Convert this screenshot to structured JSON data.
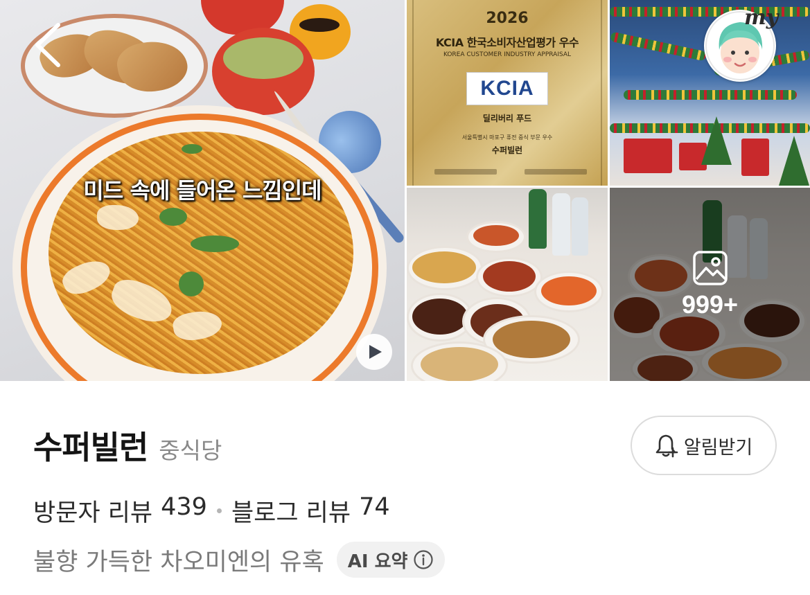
{
  "gallery": {
    "main": {
      "caption": "미드 속에 들어온 느낌인데"
    },
    "award": {
      "year": "2026",
      "title": "KCIA 한국소비자산업평가 우수",
      "subtitle": "KOREA CUSTOMER INDUSTRY APPRAISAL",
      "logo_text": "KCIA",
      "category": "딜리버리 푸드",
      "description": "서울특별시 마포구 퓨전 중식 부문 우수",
      "name": "수퍼빌런"
    },
    "my_label": "my",
    "photo_count": "999+"
  },
  "shop": {
    "name": "수퍼빌런",
    "category": "중식당",
    "notify_label": "알림받기"
  },
  "reviews": {
    "visitor_label": "방문자 리뷰",
    "visitor_count": "439",
    "blog_label": "블로그 리뷰",
    "blog_count": "74"
  },
  "summary": {
    "text": "불향 가득한 차오미엔의 유혹",
    "chip_label": "AI 요약"
  },
  "icons": {
    "back": "chevron-left-icon",
    "play": "play-icon",
    "photos": "image-icon",
    "bell": "bell-plus-icon",
    "info": "info-icon"
  },
  "colors": {
    "plate_ring": "#ec7a2b",
    "kcia_blue": "#21478f",
    "chip_bg": "#f1f1f1"
  }
}
